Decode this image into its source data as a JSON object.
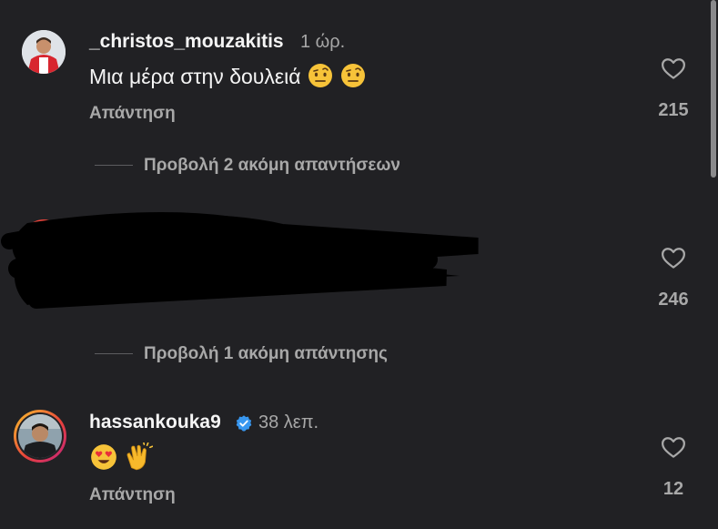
{
  "comments": [
    {
      "username": "_christos_mouzakitis",
      "time": "1 ώρ.",
      "text": "Μια μέρα στην δουλειά",
      "emojis": [
        "raised-eyebrow-emoji",
        "raised-eyebrow-emoji"
      ],
      "reply_label": "Απάντηση",
      "likes": "215",
      "view_more": "Προβολή 2 ακόμη απαντήσεων"
    },
    {
      "username": "",
      "likes": "246",
      "view_more": "Προβολή 1 ακόμη απάντησης"
    },
    {
      "username": "hassankouka9",
      "time": "38 λεπ.",
      "emojis": [
        "heart-eyes-emoji",
        "clapping-hands-emoji"
      ],
      "reply_label": "Απάντηση",
      "likes": "12",
      "verified": true
    }
  ],
  "colors": {
    "background": "#212124",
    "secondary_text": "#a8a8a8",
    "verified_blue": "#3897f0"
  }
}
